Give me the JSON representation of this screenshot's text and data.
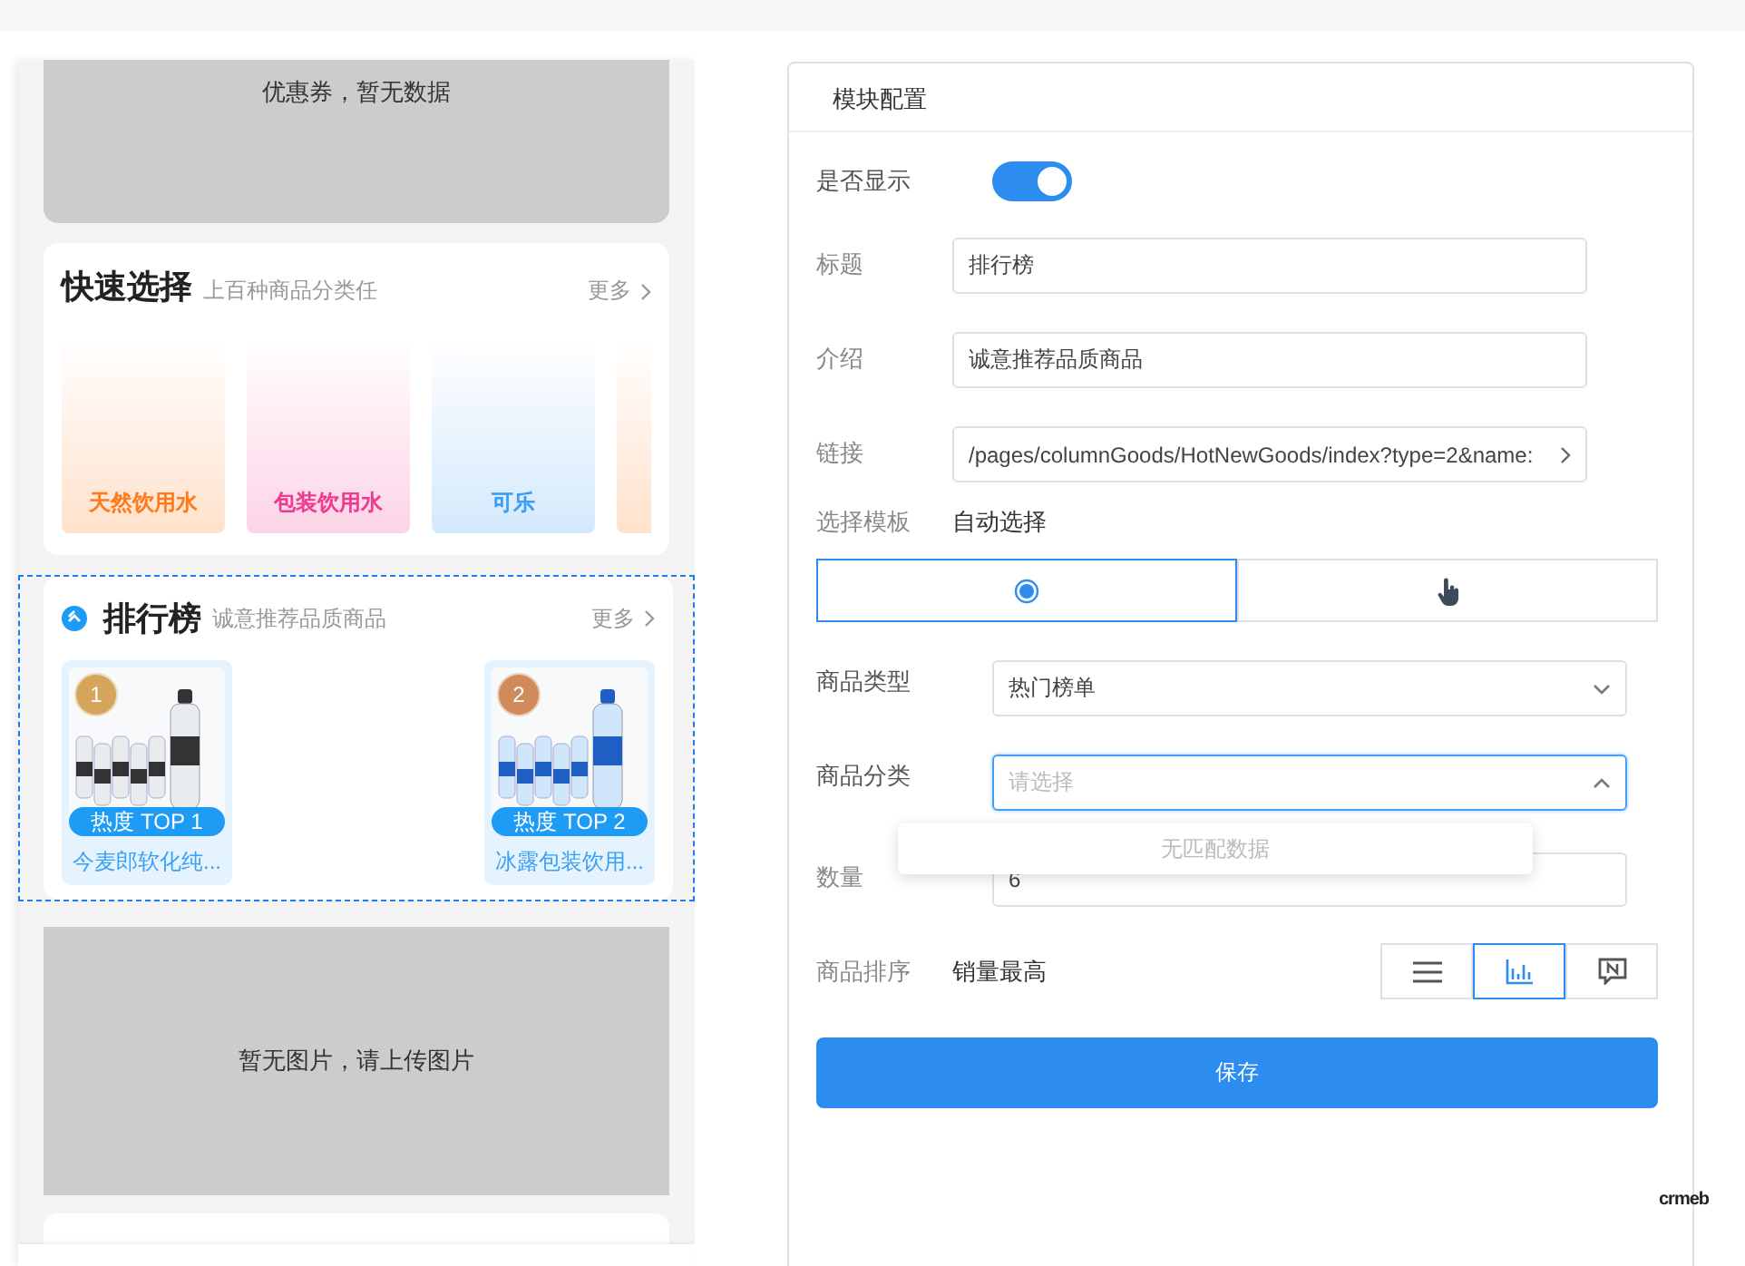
{
  "preview": {
    "coupon": {
      "text": "优惠券，暂无数据"
    },
    "quick_select": {
      "title": "快速选择",
      "subtitle": "上百种商品分类任",
      "more": "更多",
      "tiles": [
        {
          "kind": "full",
          "label": "天然饮用水",
          "color": "#ff7a1a"
        },
        {
          "kind": "full",
          "label": "包装饮用水",
          "color": "#ee3a8f"
        },
        {
          "kind": "full",
          "label": "可乐",
          "color": "#3b9cf2"
        },
        {
          "kind": "cut"
        }
      ]
    },
    "ranking": {
      "title": "排行榜",
      "subtitle": "诚意推荐品质商品",
      "more": "更多",
      "selected": true,
      "products": [
        {
          "rank": "1",
          "tag": "热度 TOP 1",
          "name": "今麦郎软化纯...",
          "color": "#d4a55a"
        },
        {
          "rank": "2",
          "tag": "热度 TOP 2",
          "name": "冰露包装饮用...",
          "color": "#d08a5c"
        }
      ]
    },
    "image_block": {
      "text": "暂无图片，请上传图片"
    }
  },
  "config": {
    "title": "模块配置",
    "show": {
      "label": "是否显示",
      "on": true
    },
    "title_field": {
      "label": "标题",
      "value": "排行榜"
    },
    "intro_field": {
      "label": "介绍",
      "value": "诚意推荐品质商品"
    },
    "link_field": {
      "label": "链接",
      "value": "/pages/columnGoods/HotNewGoods/index?type=2&name:"
    },
    "template": {
      "label": "选择模板",
      "value": "自动选择",
      "options": [
        {
          "kind": "radio",
          "selected": true
        },
        {
          "kind": "hand",
          "selected": false
        }
      ]
    },
    "goods_type": {
      "label": "商品类型",
      "value": "热门榜单",
      "expanded": false
    },
    "goods_category": {
      "label": "商品分类",
      "placeholder": "请选择",
      "expanded": true,
      "empty_text": "无匹配数据"
    },
    "quantity": {
      "label": "数量",
      "value": "6"
    },
    "sort": {
      "label": "商品排序",
      "value": "销量最高",
      "options": [
        {
          "kind": "list",
          "selected": false
        },
        {
          "kind": "bars",
          "selected": true
        },
        {
          "kind": "badge",
          "selected": false
        }
      ]
    },
    "save_button": "保存"
  },
  "logo": "crmeb"
}
